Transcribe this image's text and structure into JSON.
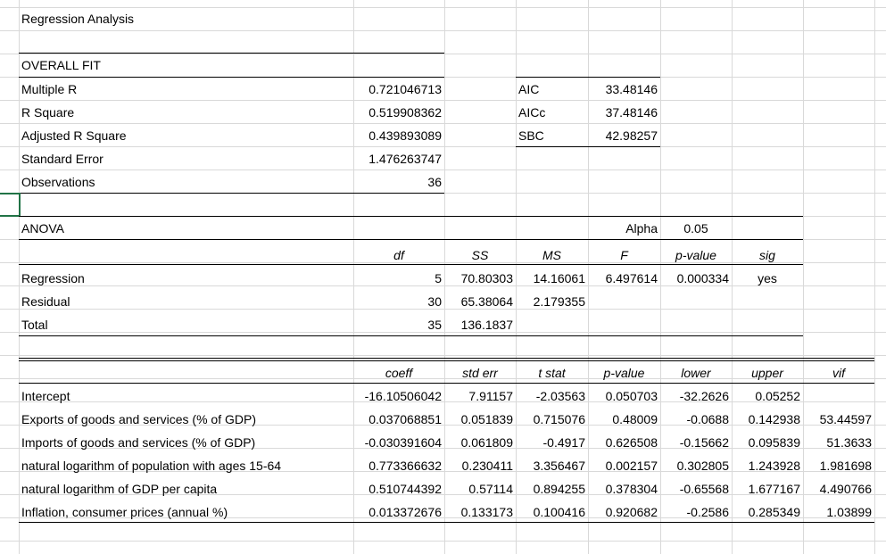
{
  "sheet": {
    "title": "Regression Analysis",
    "overall_fit": {
      "header": "OVERALL FIT",
      "rows": [
        {
          "label": "Multiple R",
          "value": "0.721046713"
        },
        {
          "label": "R Square",
          "value": "0.519908362"
        },
        {
          "label": "Adjusted R Square",
          "value": "0.439893089"
        },
        {
          "label": "Standard Error",
          "value": "1.476263747"
        },
        {
          "label": "Observations",
          "value": "36"
        }
      ],
      "criteria": [
        {
          "label": "AIC",
          "value": "33.48146"
        },
        {
          "label": "AICc",
          "value": "37.48146"
        },
        {
          "label": "SBC",
          "value": "42.98257"
        }
      ]
    },
    "anova": {
      "header": "ANOVA",
      "alpha_label": "Alpha",
      "alpha_value": "0.05",
      "columns": [
        "df",
        "SS",
        "MS",
        "F",
        "p-value",
        "sig"
      ],
      "rows": [
        {
          "label": "Regression",
          "df": "5",
          "ss": "70.80303",
          "ms": "14.16061",
          "f": "6.497614",
          "p": "0.000334",
          "sig": "yes"
        },
        {
          "label": "Residual",
          "df": "30",
          "ss": "65.38064",
          "ms": "2.179355",
          "f": "",
          "p": "",
          "sig": ""
        },
        {
          "label": "Total",
          "df": "35",
          "ss": "136.1837",
          "ms": "",
          "f": "",
          "p": "",
          "sig": ""
        }
      ]
    },
    "coefficients": {
      "columns": [
        "coeff",
        "std err",
        "t stat",
        "p-value",
        "lower",
        "upper",
        "vif"
      ],
      "rows": [
        {
          "label": "Intercept",
          "coeff": "-16.10506042",
          "se": "7.91157",
          "t": "-2.03563",
          "p": "0.050703",
          "lower": "-32.2626",
          "upper": "0.05252",
          "vif": ""
        },
        {
          "label": "Exports of goods and services (% of GDP)",
          "coeff": "0.037068851",
          "se": "0.051839",
          "t": "0.715076",
          "p": "0.48009",
          "lower": "-0.0688",
          "upper": "0.142938",
          "vif": "53.44597"
        },
        {
          "label": "Imports of goods and services (% of GDP)",
          "coeff": "-0.030391604",
          "se": "0.061809",
          "t": "-0.4917",
          "p": "0.626508",
          "lower": "-0.15662",
          "upper": "0.095839",
          "vif": "51.3633"
        },
        {
          "label": "natural logarithm of population with ages 15-64",
          "coeff": "0.773366632",
          "se": "0.230411",
          "t": "3.356467",
          "p": "0.002157",
          "lower": "0.302805",
          "upper": "1.243928",
          "vif": "1.981698"
        },
        {
          "label": "natural logarithm of GDP per capita",
          "coeff": "0.510744392",
          "se": "0.57114",
          "t": "0.894255",
          "p": "0.378304",
          "lower": "-0.65568",
          "upper": "1.677167",
          "vif": "4.490766"
        },
        {
          "label": "Inflation, consumer prices (annual %)",
          "coeff": "0.013372676",
          "se": "0.133173",
          "t": "0.100416",
          "p": "0.920682",
          "lower": "-0.2586",
          "upper": "0.285349",
          "vif": "1.03899"
        }
      ]
    }
  }
}
